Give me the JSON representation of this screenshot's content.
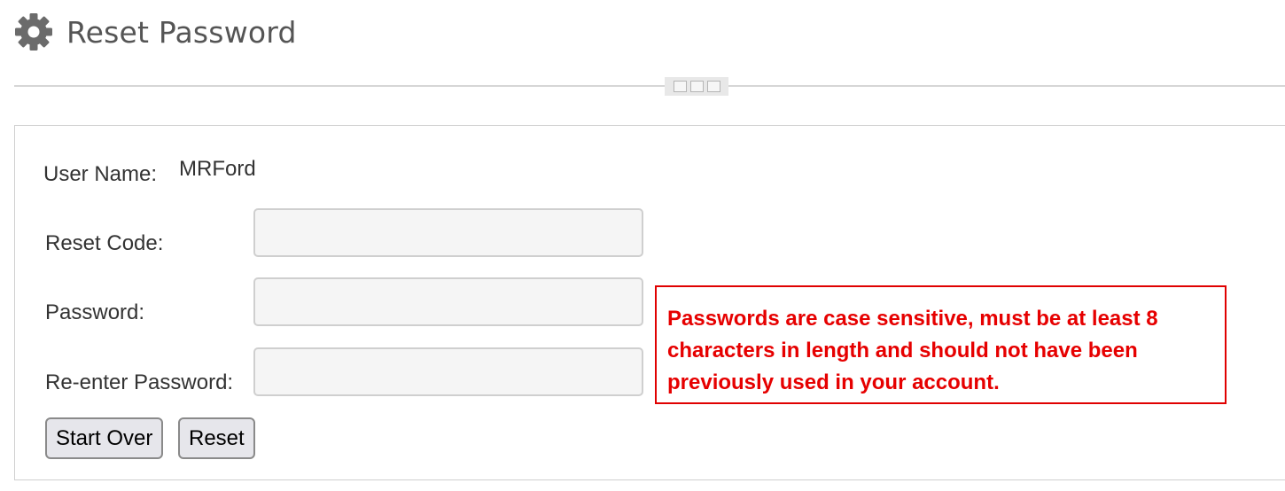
{
  "header": {
    "title": "Reset Password",
    "icon": "gear-icon"
  },
  "form": {
    "user_name_label": "User Name:",
    "user_name_value": "MRFord",
    "reset_code_label": "Reset Code:",
    "reset_code_value": "",
    "password_label": "Password:",
    "password_value": "",
    "reenter_password_label": "Re-enter Password:",
    "reenter_password_value": ""
  },
  "notice": {
    "text": "Passwords are case sensitive, must be at least 8 characters in length and should not have been previously used in your account.",
    "color": "#e60000"
  },
  "buttons": {
    "start_over_label": "Start Over",
    "reset_label": "Reset"
  }
}
